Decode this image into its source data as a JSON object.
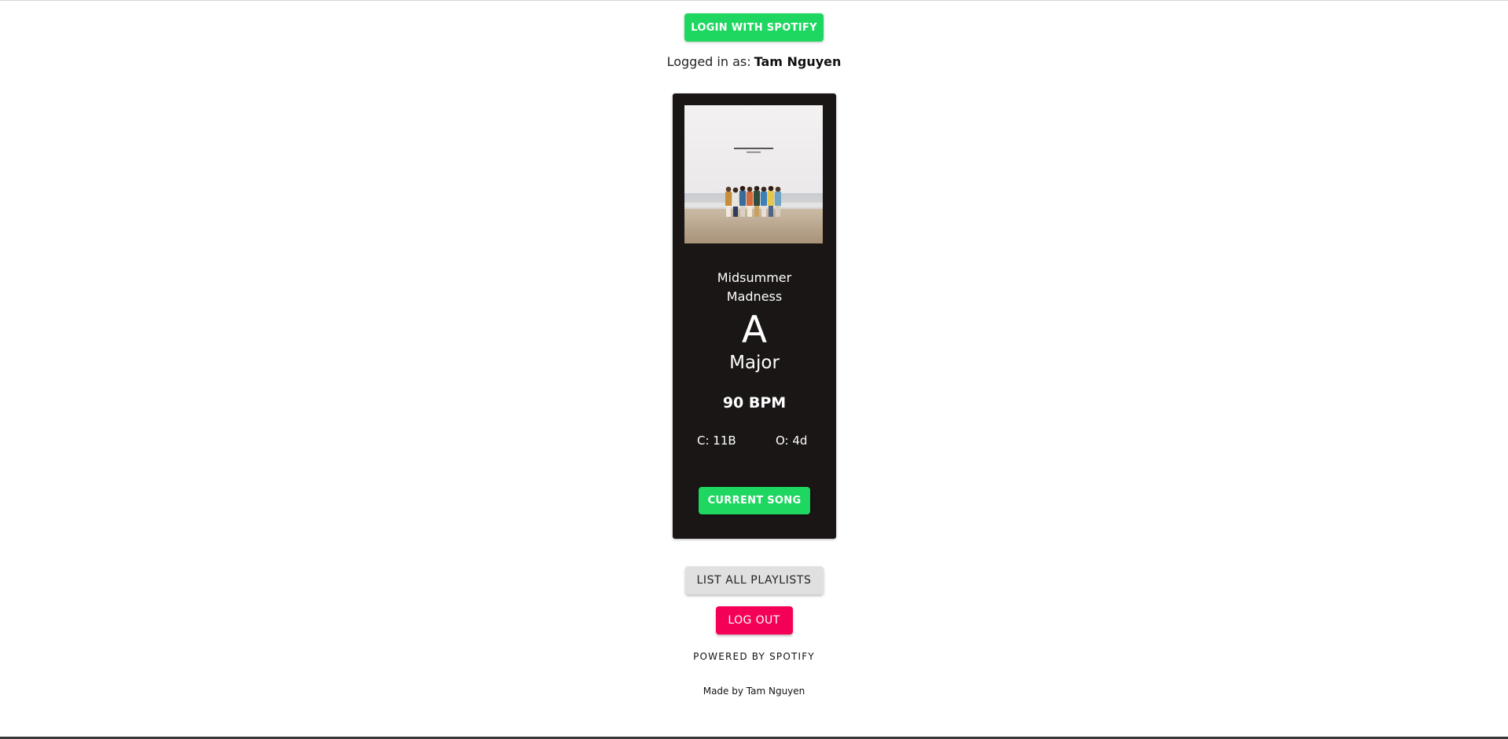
{
  "header": {
    "login_button_label": "LOGIN WITH SPOTIFY",
    "logged_in_prefix": "Logged in as:",
    "user_name": "Tam Nguyen"
  },
  "now_playing": {
    "album_art_icon": "album-cover-image",
    "track_title": "Midsummer Madness",
    "key_letter": "A",
    "key_mode": "Major",
    "bpm": "90 BPM",
    "camelot": "C: 11B",
    "open_key": "O: 4d",
    "current_song_button_label": "CURRENT SONG"
  },
  "actions": {
    "list_playlists_label": "LIST ALL PLAYLISTS",
    "log_out_label": "LOG OUT"
  },
  "footer": {
    "powered_by": "POWERED BY SPOTIFY",
    "made_by": "Made by Tam Nguyen"
  },
  "colors": {
    "spotify_green": "#1ed760",
    "card_background": "#191615",
    "logout_pink": "#f50057",
    "secondary_grey": "#e0e0e0"
  }
}
